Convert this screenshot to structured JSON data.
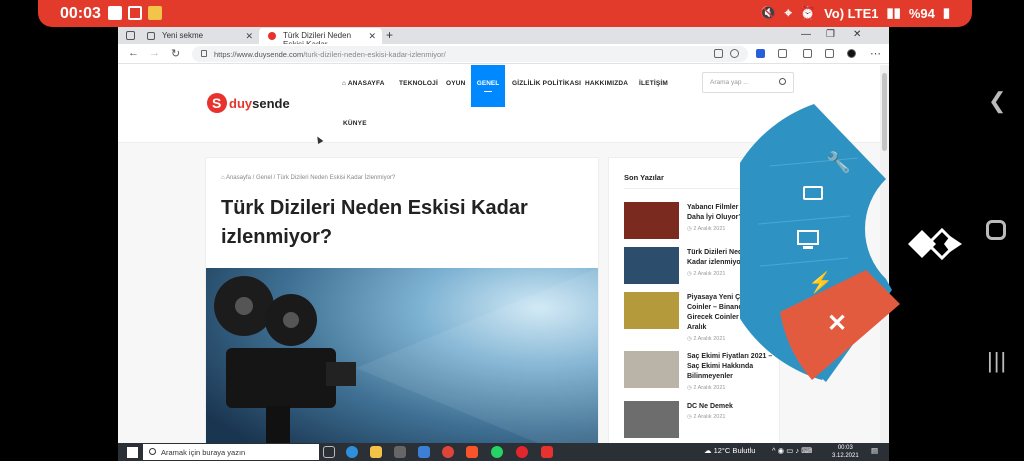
{
  "status_bar": {
    "time": "00:03",
    "network": "Vo) LTE1",
    "battery": "%94"
  },
  "browser": {
    "tabs": [
      {
        "label": "Yeni sekme"
      },
      {
        "label": "Türk Dizileri Neden Eskisi Kadar"
      }
    ],
    "url_host": "https://www.duysende.com",
    "url_path": "/turk-dizileri-neden-eskisi-kadar-izlenmiyor/"
  },
  "site": {
    "logo": {
      "left": "duy",
      "right": "sende"
    },
    "menu": [
      {
        "label": "ANASAYFA"
      },
      {
        "label": "TEKNOLOJİ"
      },
      {
        "label": "OYUN"
      },
      {
        "label": "GENEL"
      },
      {
        "label": "GİZLİLİK POLİTİKASI"
      },
      {
        "label": "HAKKIMIZDA"
      },
      {
        "label": "İLETİŞİM"
      },
      {
        "label": "KÜNYE"
      }
    ],
    "search_placeholder": "Arama yap ...",
    "breadcrumb": "⌂ Anasayfa / Genel / Türk Dizileri Neden Eskisi Kadar İzlenmiyor?",
    "article_title": "Türk Dizileri Neden Eskisi Kadar izlenmiyor?",
    "sidebar_title": "Son Yazılar",
    "posts": [
      {
        "title": "Yabancı Filmler Neden Daha İyi Oluyor?",
        "date": "◷ 2 Aralık 2021",
        "color": "#7a2a1e"
      },
      {
        "title": "Türk Dizileri Neden Eskisi Kadar izlenmiyor?",
        "date": "◷ 2 Aralık 2021",
        "color": "#2c4d6b"
      },
      {
        "title": "Piyasaya Yeni Çıkacak Coinler – Binance Yeni Girecek Coinler 2021 Aralık",
        "date": "◷ 2 Aralık 2021",
        "color": "#b49a3a"
      },
      {
        "title": "Saç Ekimi Fiyatları 2021 – Saç Ekimi Hakkında Bilinmeyenler",
        "date": "◷ 2 Aralık 2021",
        "color": "#b9b3a8"
      },
      {
        "title": "DC Ne Demek",
        "date": "◷ 2 Aralık 2021",
        "color": "#6d6d6d"
      }
    ]
  },
  "taskbar": {
    "search_placeholder": "Aramak için buraya yazın",
    "weather": "12°C Bulutlu",
    "time": "00:03",
    "date": "3.12.2021"
  },
  "overlay": {
    "icons": [
      "wrench-icon",
      "keyboard-mouse-icon",
      "monitor-icon",
      "lightning-icon",
      "close-icon"
    ],
    "colors": {
      "blue": "#2e93c3",
      "red": "#e35b3f"
    }
  }
}
